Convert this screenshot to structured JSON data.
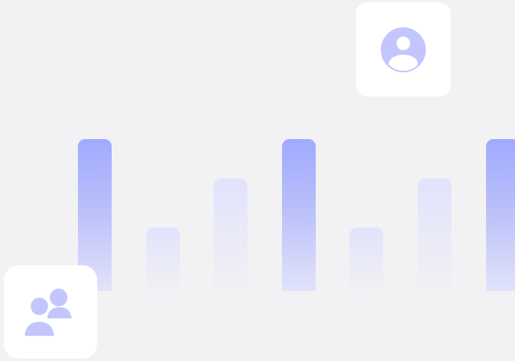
{
  "illustration": {
    "bars": [
      {
        "level": 1.0,
        "tone": "strong"
      },
      {
        "level": 0.42,
        "tone": "soft"
      },
      {
        "level": 0.74,
        "tone": "soft"
      },
      {
        "level": 1.0,
        "tone": "strong"
      },
      {
        "level": 0.42,
        "tone": "soft"
      },
      {
        "level": 0.74,
        "tone": "soft"
      },
      {
        "level": 1.0,
        "tone": "strong"
      }
    ],
    "icons": {
      "single_user": "user-circle-icon",
      "group": "users-group-icon"
    },
    "colors": {
      "background": "#f2f2f5",
      "accent": "#a1a9ff",
      "icon": "#c3c6fc",
      "card": "#ffffff"
    }
  }
}
